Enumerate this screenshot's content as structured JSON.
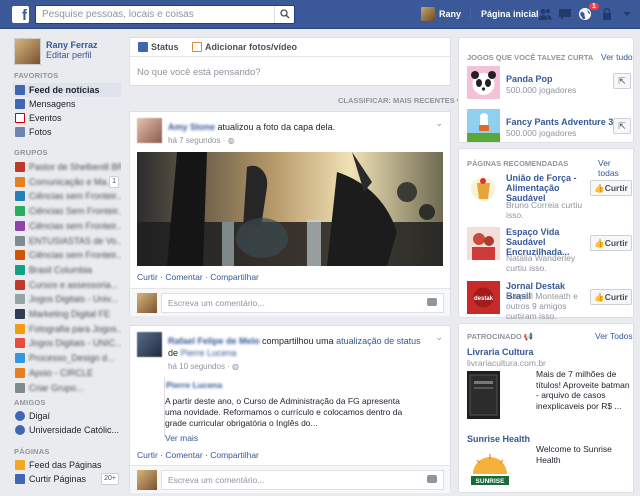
{
  "topbar": {
    "logo": "f",
    "search_placeholder": "Pesquise pessoas, locais e coisas",
    "user_name": "Rany",
    "home_label": "Página inicial",
    "notification_count": "1"
  },
  "left": {
    "profile_name": "Rany Ferraz",
    "edit_profile": "Editar perfil",
    "favorites_header": "FAVORITOS",
    "favorites": [
      {
        "label": "Feed de notícias"
      },
      {
        "label": "Mensagens"
      },
      {
        "label": "Eventos"
      },
      {
        "label": "Fotos"
      }
    ],
    "groups_header": "GRUPOS",
    "groups": [
      {
        "label": "Pastor de Shelbenill BR"
      },
      {
        "label": "Comunicação e Ma...",
        "count": "1"
      },
      {
        "label": "Ciências sem Fronteir..."
      },
      {
        "label": "Ciências Sem Fronteir..."
      },
      {
        "label": "Ciências sem Fronteir..."
      },
      {
        "label": "ENTUSIASTAS de Vo..."
      },
      {
        "label": "Ciências sem Fronteir..."
      },
      {
        "label": "Brasil Columbia"
      },
      {
        "label": "Cursos e assessoria..."
      },
      {
        "label": "Jogos Digitais - Univ..."
      },
      {
        "label": "Marketing Digital FE"
      },
      {
        "label": "Fotografia para Jogos..."
      },
      {
        "label": "Jogos Digitais - UNIC..."
      },
      {
        "label": "Processo_Design d..."
      },
      {
        "label": "Apoio - CIRCLE"
      },
      {
        "label": "Criar Grupo..."
      }
    ],
    "friends_header": "AMIGOS",
    "friends": [
      {
        "label": "Digaí"
      },
      {
        "label": "Universidade Católic..."
      }
    ],
    "pages_header": "PÁGINAS",
    "pages": [
      {
        "label": "Feed das Páginas"
      },
      {
        "label": "Curtir Páginas",
        "count": "20+"
      }
    ]
  },
  "composer": {
    "status_tab": "Status",
    "photo_tab": "Adicionar fotos/vídeo",
    "placeholder": "No que você está pensando?"
  },
  "sort_label": "CLASSIFICAR: MAIS RECENTES ▾",
  "posts": [
    {
      "author": "Amy Stone",
      "action": " atualizou a foto da capa dela.",
      "time": "há 7 segundos · ",
      "actions": [
        "Curtir",
        "Comentar",
        "Compartilhar"
      ],
      "comment_placeholder": "Escreva um comentário..."
    },
    {
      "author": "Rafael Felipe de Melo",
      "action_pre": " compartilhou uma ",
      "action_link": "atualização de status",
      "action_mid": " de ",
      "target": "Pierre Lucena",
      "time": "há 10 segundos · ",
      "shared_author": "Pierre Lucena",
      "shared_text": "A partir deste ano, o Curso de Administração da FG apresenta uma novidade. Reformamos o currículo e colocamos dentro da grade curricular obrigatória o Inglês do...",
      "more": "Ver mais",
      "actions": [
        "Curtir",
        "Comentar",
        "Compartilhar"
      ],
      "comment_placeholder": "Escreva um comentário..."
    }
  ],
  "right": {
    "games_header": "JOGOS QUE VOCÊ TALVEZ CURTA",
    "games_all": "Ver tudo",
    "games": [
      {
        "title": "Panda Pop",
        "players": "500.000 jogadores"
      },
      {
        "title": "Fancy Pants Adventure 3",
        "players": "500.000 jogadores"
      }
    ],
    "pages_header": "PÁGINAS RECOMENDADAS",
    "pages_all": "Ver todas",
    "rec_pages": [
      {
        "title": "União de Força - Alimentação Saudável",
        "sub": "Bruno Correia curtiu isso.",
        "btn": "Curtir"
      },
      {
        "title": "Espaço Vida Saudável Encruzilhada...",
        "sub": "Natália Wanderley curtiu isso.",
        "btn": "Curtir"
      },
      {
        "title": "Jornal Destak Brasil",
        "sub": "Raquel Monteath e outros 9 amigos curtiram isso.",
        "btn": "Curtir"
      }
    ],
    "sponsored_header": "PATROCINADO",
    "sponsored_all": "Ver Todos",
    "ads": [
      {
        "title": "Livraria Cultura",
        "url": "livrariacultura.com.br",
        "text": "Mais de 7 milhões de títulos! Aproveite batman - arquivo de casos inexplicaveis por R$ ..."
      },
      {
        "title": "Sunrise Health",
        "text": "Welcome to Sunrise Health",
        "logo_text": "SUNRISE"
      }
    ]
  },
  "colors": {
    "brand": "#3b5998",
    "link": "#365899",
    "background": "#e9ebee"
  }
}
